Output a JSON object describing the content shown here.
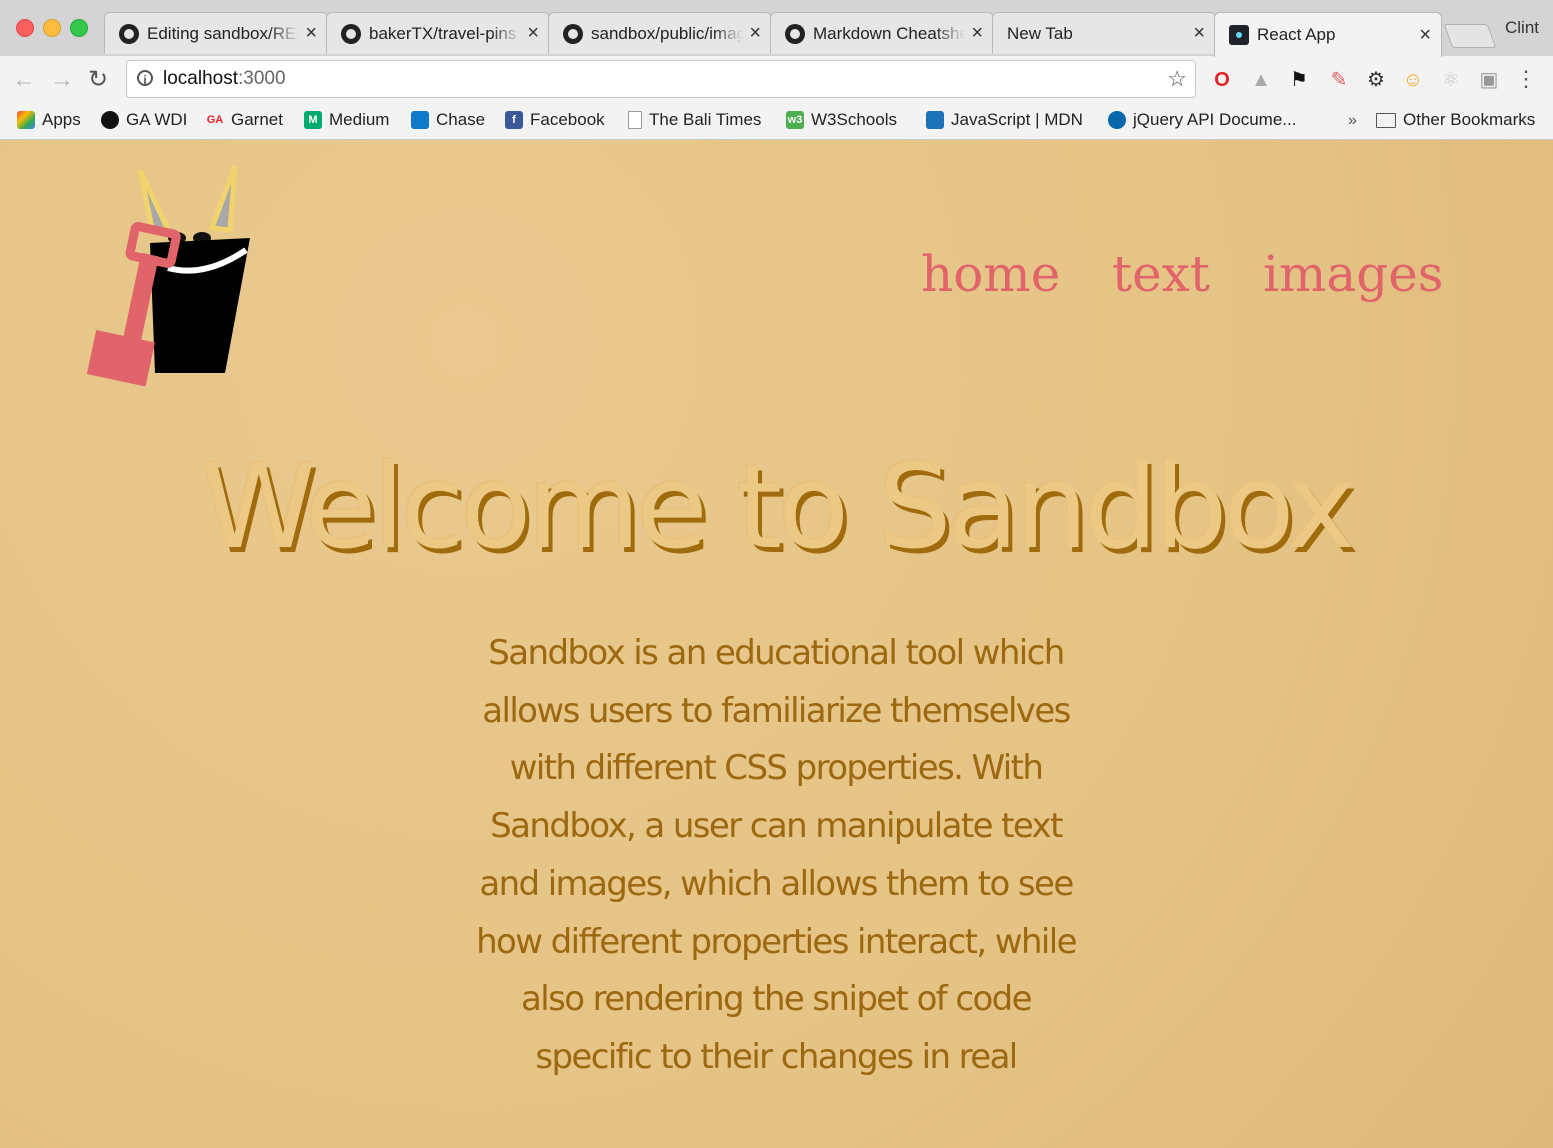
{
  "browser": {
    "tabs": [
      {
        "title": "Editing sandbox/README",
        "close": "×"
      },
      {
        "title": "bakerTX/travel-pins",
        "close": "×"
      },
      {
        "title": "sandbox/public/images",
        "close": "×"
      },
      {
        "title": "Markdown Cheatsheet",
        "close": "×"
      },
      {
        "title": "New Tab",
        "close": "×"
      },
      {
        "title": "React App",
        "close": "×"
      }
    ],
    "profile_name": "Clint",
    "url_host": "localhost",
    "url_port": ":3000",
    "bookmarks": [
      {
        "label": "Apps"
      },
      {
        "label": "GA WDI"
      },
      {
        "label": "Garnet"
      },
      {
        "label": "Medium"
      },
      {
        "label": "Chase"
      },
      {
        "label": "Facebook"
      },
      {
        "label": "The Bali Times"
      },
      {
        "label": "W3Schools"
      },
      {
        "label": "JavaScript | MDN"
      },
      {
        "label": "jQuery API Docume..."
      }
    ],
    "bookmarks_more": "»",
    "other_bookmarks": "Other Bookmarks"
  },
  "page": {
    "nav": {
      "home": "home",
      "text": "text",
      "images": "images"
    },
    "heading": "Welcome to Sandbox",
    "intro": "Sandbox is an educational tool which allows users to familiarize themselves with different CSS properties. With Sandbox, a user can manipulate text and images, which allows them to see how different properties interact, while also rendering the snipet of code specific to their changes in real"
  },
  "colors": {
    "background": "#e5c384",
    "nav_link": "#e0646a",
    "heading_fill": "#ecc885",
    "heading_shadow": "#a06b0c",
    "body_text": "#9c6810"
  }
}
